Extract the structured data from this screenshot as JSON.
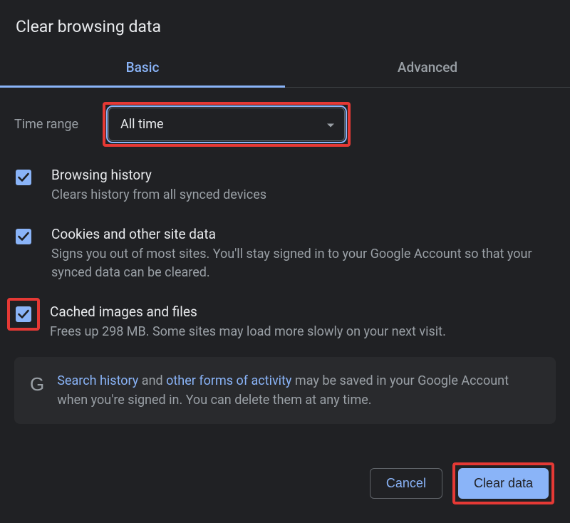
{
  "title": "Clear browsing data",
  "tabs": {
    "basic": "Basic",
    "advanced": "Advanced"
  },
  "timeRange": {
    "label": "Time range",
    "value": "All time"
  },
  "items": [
    {
      "title": "Browsing history",
      "desc": "Clears history from all synced devices"
    },
    {
      "title": "Cookies and other site data",
      "desc": "Signs you out of most sites. You'll stay signed in to your Google Account so that your synced data can be cleared."
    },
    {
      "title": "Cached images and files",
      "desc": "Frees up 298 MB. Some sites may load more slowly on your next visit."
    }
  ],
  "notice": {
    "link1": "Search history",
    "mid1": " and ",
    "link2": "other forms of activity",
    "rest": " may be saved in your Google Account when you're signed in. You can delete them at any time."
  },
  "buttons": {
    "cancel": "Cancel",
    "clear": "Clear data"
  }
}
